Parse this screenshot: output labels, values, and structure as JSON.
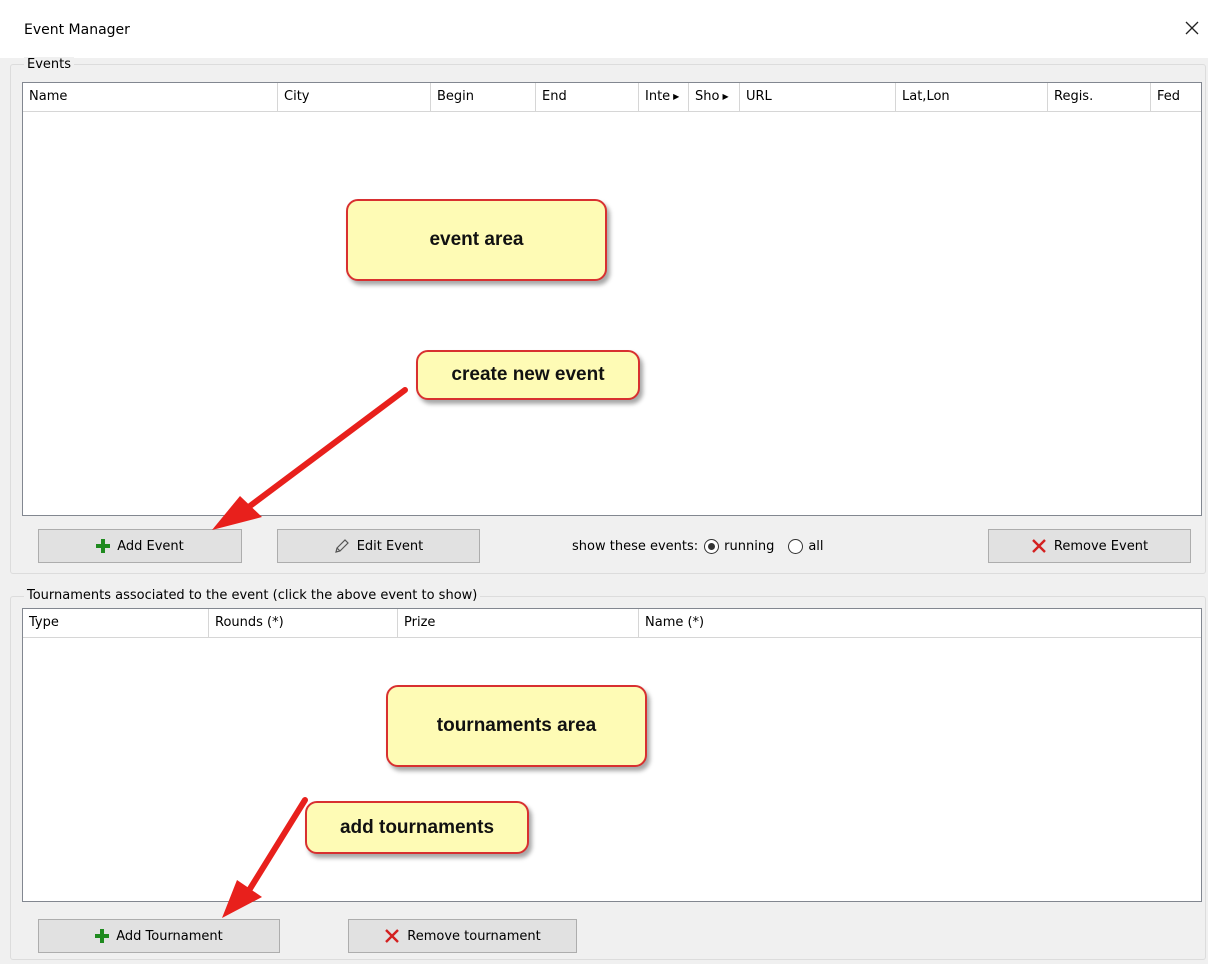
{
  "window": {
    "title": "Event Manager",
    "close_icon": "close-icon"
  },
  "events_group": {
    "label": "Events",
    "columns": [
      "Name",
      "City",
      "Begin",
      "End",
      "Inte",
      "Sho",
      "URL",
      "Lat,Lon",
      "Regis.",
      "Fed"
    ],
    "rows": []
  },
  "events_toolbar": {
    "add_label": "Add Event",
    "edit_label": "Edit Event",
    "remove_label": "Remove Event",
    "filter_label": "show these events:",
    "filter_options": [
      "running",
      "all"
    ],
    "filter_selected": "running"
  },
  "tournaments_group": {
    "label": "Tournaments associated to the event (click the above event to show)",
    "columns": [
      "Type",
      "Rounds (*)",
      "Prize",
      "Name (*)"
    ],
    "rows": []
  },
  "tournaments_toolbar": {
    "add_label": "Add Tournament",
    "remove_label": "Remove tournament"
  },
  "annotations": {
    "event_area": "event area",
    "create_new_event": "create new event",
    "tournaments_area": "tournaments area",
    "add_tournaments": "add tournaments"
  },
  "colors": {
    "add_icon": "#1f8a1f",
    "remove_icon": "#d32020",
    "callout_fill": "#fefbb5",
    "callout_border": "#d83030",
    "arrow": "#e8201c"
  }
}
